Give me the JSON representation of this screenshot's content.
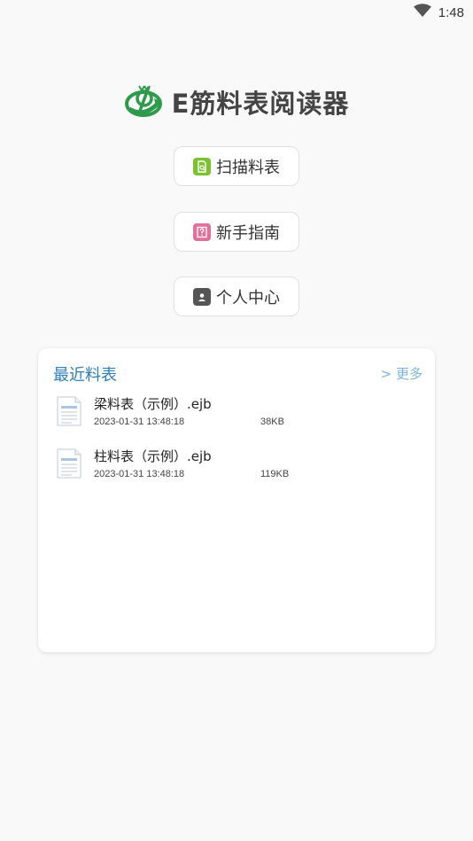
{
  "status_bar": {
    "time": "1:48"
  },
  "app": {
    "title": "E筋料表阅读器"
  },
  "menu": [
    {
      "label": "扫描料表",
      "icon": "scan-doc-icon",
      "color": "#7cc12f"
    },
    {
      "label": "新手指南",
      "icon": "question-icon",
      "color": "#e0719a"
    },
    {
      "label": "个人中心",
      "icon": "contact-card-icon",
      "color": "#555555"
    }
  ],
  "recent": {
    "title": "最近料表",
    "more": "> 更多",
    "files": [
      {
        "name": "梁料表（示例）.ejb",
        "date": "2023-01-31  13:48:18",
        "size": "38KB"
      },
      {
        "name": "柱料表（示例）.ejb",
        "date": "2023-01-31  13:48:18",
        "size": "119KB"
      }
    ]
  },
  "colors": {
    "accent": "#2b7fb8",
    "logo_green": "#2e9a4c",
    "background": "#f9f9f9"
  }
}
